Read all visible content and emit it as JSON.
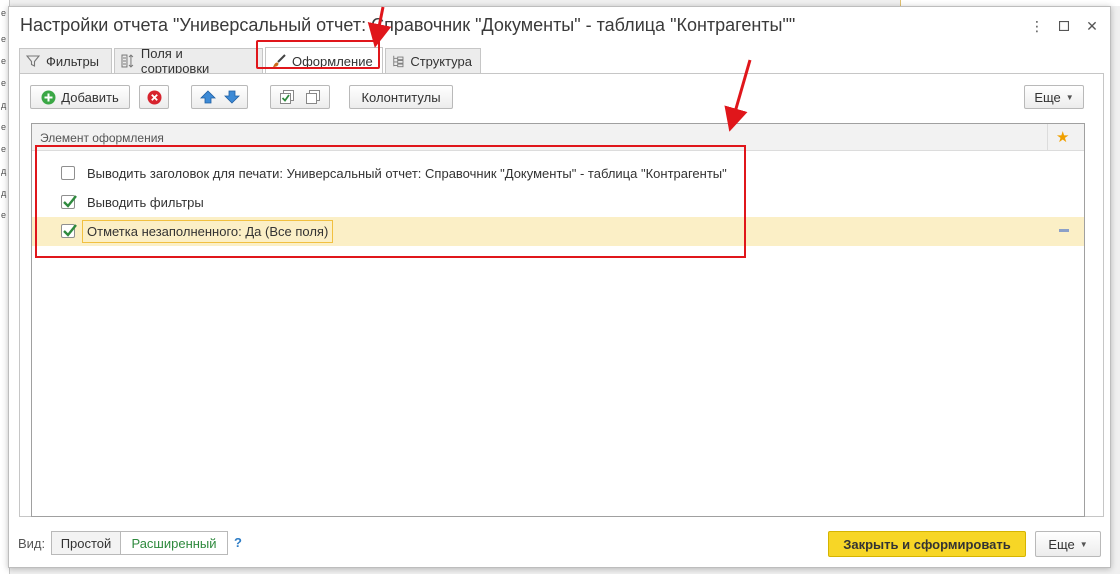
{
  "window": {
    "title": "Настройки отчета \"Универсальный отчет: Справочник \"Документы\" - таблица \"Контрагенты\"\""
  },
  "tabs": [
    {
      "label": "Фильтры",
      "icon": "filter-icon",
      "active": false
    },
    {
      "label": "Поля и сортировки",
      "icon": "fields-sort-icon",
      "active": false
    },
    {
      "label": "Оформление",
      "icon": "brush-icon",
      "active": true
    },
    {
      "label": "Структура",
      "icon": "structure-icon",
      "active": false
    }
  ],
  "toolbar": {
    "add_label": "Добавить",
    "headers_footers_label": "Колонтитулы",
    "more_label": "Еще"
  },
  "grid": {
    "column_header": "Элемент оформления",
    "rows": [
      {
        "label": "Выводить заголовок для печати: Универсальный отчет: Справочник \"Документы\" - таблица \"Контрагенты\"",
        "checked": false,
        "selected": false
      },
      {
        "label": "Выводить фильтры",
        "checked": true,
        "selected": false
      },
      {
        "label": "Отметка незаполненного: Да (Все поля)",
        "checked": true,
        "selected": true
      }
    ]
  },
  "bottom": {
    "view_label": "Вид:",
    "simple_label": "Простой",
    "extended_label": "Расширенный",
    "help_label": "?",
    "primary_label": "Закрыть и сформировать",
    "more_label": "Еще"
  },
  "colors": {
    "accent_yellow": "#f7d626",
    "annotation_red": "#e0161b",
    "selected_row": "#fbefc6",
    "link_green": "#2f8a3e"
  }
}
